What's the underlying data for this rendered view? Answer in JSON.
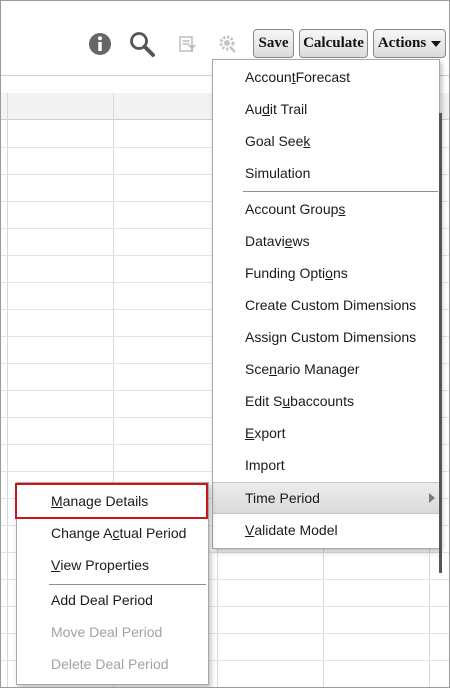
{
  "toolbar": {
    "save_label": "Save",
    "calculate_label": "Calculate",
    "actions_label": "Actions",
    "icons": [
      "info-icon",
      "search-icon",
      "filter-icon",
      "settings-gear-icon",
      "chevron-down-icon"
    ]
  },
  "actions_menu": {
    "items": [
      {
        "pre": "Accoun",
        "u": "t",
        "post": " Forecast"
      },
      {
        "pre": "Au",
        "u": "d",
        "post": "it Trail"
      },
      {
        "pre": "Goal See",
        "u": "k",
        "post": ""
      },
      {
        "pre": "Simulation",
        "u": "",
        "post": ""
      },
      {
        "pre": "Account Group",
        "u": "s",
        "post": ""
      },
      {
        "pre": "Datavi",
        "u": "e",
        "post": "ws"
      },
      {
        "pre": "Funding Opti",
        "u": "o",
        "post": "ns"
      },
      {
        "pre": "Create Custom Dimensions",
        "u": "",
        "post": ""
      },
      {
        "pre": "Assign Custom Dimensions",
        "u": "",
        "post": ""
      },
      {
        "pre": "Sce",
        "u": "n",
        "post": "ario Manager"
      },
      {
        "pre": "Edit S",
        "u": "u",
        "post": "baccounts"
      },
      {
        "pre": "",
        "u": "E",
        "post": "xport"
      },
      {
        "pre": "Import",
        "u": "",
        "post": ""
      },
      {
        "pre": "Time Period",
        "u": "",
        "post": ""
      },
      {
        "pre": "",
        "u": "V",
        "post": "alidate Model"
      }
    ]
  },
  "time_period_submenu": {
    "items": [
      {
        "pre": "",
        "u": "M",
        "post": "anage Details"
      },
      {
        "pre": "Change A",
        "u": "c",
        "post": "tual Period"
      },
      {
        "pre": "",
        "u": "V",
        "post": "iew Properties"
      },
      {
        "pre": "Add Deal Period",
        "u": "",
        "post": ""
      },
      {
        "pre": "Move Deal Period",
        "u": "",
        "post": ""
      },
      {
        "pre": "Delete Deal Period",
        "u": "",
        "post": ""
      }
    ]
  },
  "colors": {
    "focus_outline": "#c8161d",
    "disabled_text": "#a2a2a2",
    "highlight_bg": "#dedede"
  }
}
